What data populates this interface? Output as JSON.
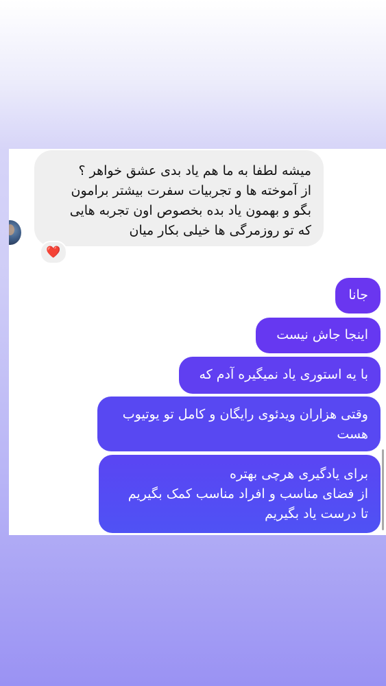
{
  "incoming_message": {
    "lines": [
      "میشه لطفا به ما هم یاد بدی عشق خواهر ؟",
      "از آموخته ها و تجربیات سفرت بیشتر برامون",
      "بگو و بهمون یاد بده بخصوص اون تجربه هایی",
      "که تو روزمرگی ها خیلی بکار میان"
    ],
    "reaction": "❤️"
  },
  "outgoing_messages": [
    {
      "lines": [
        "جانا"
      ]
    },
    {
      "lines": [
        "اینجا جاش نیست"
      ]
    },
    {
      "lines": [
        "با یه استوری یاد نمیگیره آدم که"
      ]
    },
    {
      "lines": [
        "وقتی هزاران ویدئوی رایگان و کامل تو یوتیوب",
        "هست"
      ]
    },
    {
      "lines": [
        "برای یادگیری هرچی بهتره",
        "از فضای مناسب و افراد مناسب کمک بگیریم",
        "تا درست یاد بگیریم"
      ]
    }
  ],
  "colors": {
    "incoming_bubble": "#efefef",
    "outgoing_top": "#6a36f0",
    "outgoing_bottom": "#4f52f4",
    "heart": "#e0202f"
  },
  "icons": {
    "avatar": "user-avatar-photo",
    "reaction": "red-heart-icon"
  }
}
